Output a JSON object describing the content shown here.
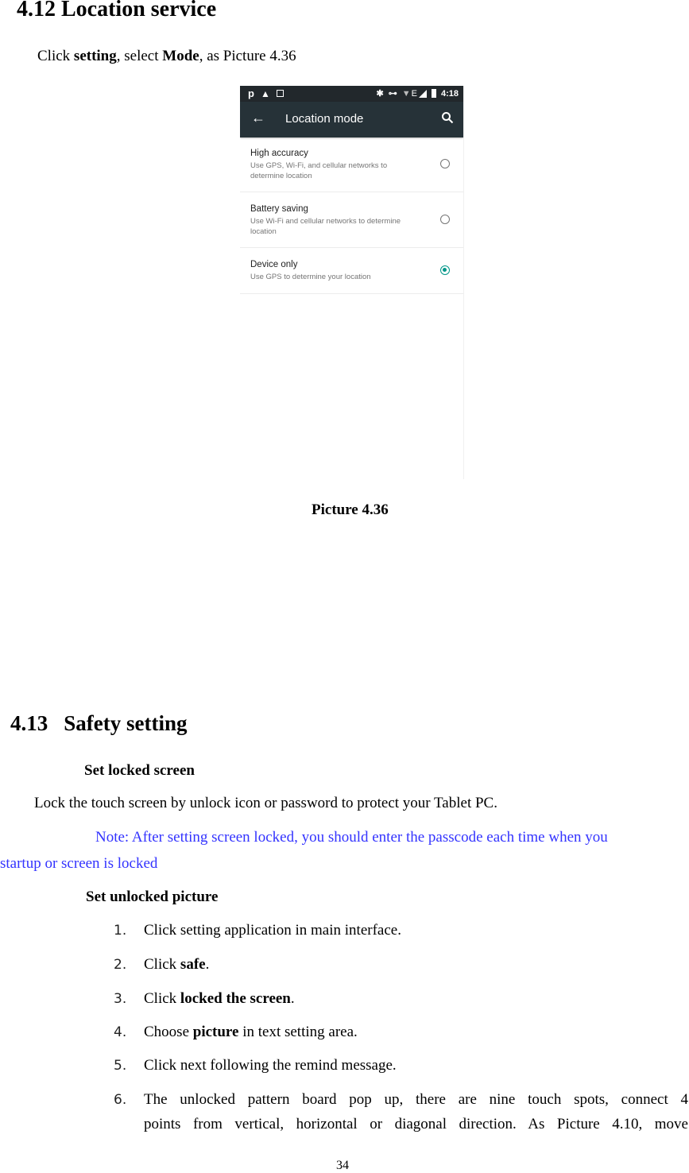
{
  "section_412": {
    "heading": "4.12 Location service",
    "intro": {
      "p1": "Click ",
      "b1": "setting",
      "p2": ", select ",
      "b2": "Mode",
      "p3": ", as Picture 4.36"
    },
    "figure_caption": "Picture 4.36"
  },
  "phone": {
    "status_bar": {
      "left_icons": [
        "p-app-icon",
        "warning-icon",
        "image-icon"
      ],
      "right_icons": [
        "bluetooth-icon",
        "vpn-key-icon",
        "wifi-icon",
        "signal-icon",
        "battery-icon"
      ],
      "network_type": "E",
      "time": "4:18"
    },
    "toolbar": {
      "title": "Location mode",
      "back_icon": "arrow-left-icon",
      "search_icon": "search-icon"
    },
    "options": [
      {
        "title": "High accuracy",
        "subtitle": "Use GPS, Wi-Fi, and cellular networks to determine location",
        "selected": false
      },
      {
        "title": "Battery saving",
        "subtitle": "Use Wi-Fi and cellular networks to determine location",
        "selected": false
      },
      {
        "title": "Device only",
        "subtitle": "Use GPS to determine your location",
        "selected": true
      }
    ],
    "colors": {
      "status_bar": "#22282c",
      "toolbar": "#263238",
      "accent": "#009688"
    }
  },
  "section_413": {
    "heading_num": "4.13",
    "heading_text": "Safety setting",
    "sub1": "Set locked screen",
    "para1": "Lock the touch screen by unlock icon or password to protect your Tablet PC.",
    "note_line1": "Note: After setting screen locked, you should enter the passcode each time when you",
    "note_line2": "startup or screen is locked",
    "note_color": "#3333ff",
    "sub2": "Set unlocked picture",
    "steps": [
      {
        "num": "1.",
        "pre": "Click setting application in main interface.",
        "bold": "",
        "post": ""
      },
      {
        "num": "2.",
        "pre": "Click ",
        "bold": "safe",
        "post": "."
      },
      {
        "num": "3.",
        "pre": "Click ",
        "bold": "locked the screen",
        "post": "."
      },
      {
        "num": "4.",
        "pre": "Choose ",
        "bold": "picture",
        "post": " in text setting area."
      },
      {
        "num": "5.",
        "pre": "Click next following the remind message.",
        "bold": "",
        "post": ""
      },
      {
        "num": "6.",
        "pre": "The unlocked pattern board pop up, there are nine touch spots, connect 4",
        "bold": "",
        "post": "",
        "line2": "points from vertical, horizontal or diagonal direction. As Picture 4.10, move"
      }
    ]
  },
  "page_number": "34"
}
